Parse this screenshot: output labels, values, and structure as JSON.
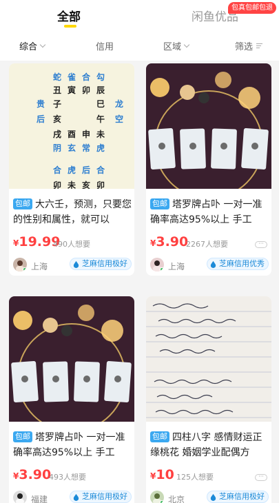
{
  "tabs": {
    "all": "全部",
    "xianyu_pick": "闲鱼优品",
    "promo": "包真包邮包退"
  },
  "filters": {
    "comprehensive": "综合",
    "credit": "信用",
    "region": "区域",
    "filter": "筛选"
  },
  "products": [
    {
      "badge": "包邮",
      "title": "大六壬，预测，只要您的性别和属性，就可以",
      "currency": "¥",
      "price": "19.99",
      "wants": "490人想要",
      "location": "上海",
      "credit": "芝麻信用极好"
    },
    {
      "badge": "包邮",
      "title": "塔罗牌占卟 一对一准确率高达95%以上 手工",
      "currency": "¥",
      "price": "3.90",
      "wants": "2267人想要",
      "location": "上海",
      "credit": "芝麻信用优秀"
    },
    {
      "badge": "包邮",
      "title": "塔罗牌占卟 一对一准确率高达95%以上 手工",
      "currency": "¥",
      "price": "3.90",
      "wants": "493人想要",
      "location": "福建",
      "credit": "芝麻信用极好"
    },
    {
      "badge": "包邮",
      "title": "四柱八字  感情财运正缘桃花  婚姻学业配偶方",
      "currency": "¥",
      "price": "10",
      "wants": "125人想要",
      "location": "北京",
      "credit": "芝麻信用极好"
    }
  ],
  "chart_text": {
    "rows": [
      [
        "蛇",
        "雀",
        "合",
        "勾"
      ],
      [
        "丑",
        "寅",
        "卯",
        "辰"
      ],
      [
        "贵",
        "子",
        "巳",
        "龙"
      ],
      [
        "后",
        "亥",
        "午",
        "空"
      ],
      [
        "戌",
        "酉",
        "申",
        "未"
      ],
      [
        "阴",
        "玄",
        "常",
        "虎"
      ],
      [
        "合",
        "虎",
        "后",
        "合"
      ],
      [
        "卯",
        "未",
        "亥",
        "卯"
      ]
    ]
  },
  "colors": {
    "accent_yellow": "#ffd800",
    "price_red": "#ff4040",
    "badge_blue": "#3ba8f0",
    "credit_blue": "#1b8ad8",
    "promo_red": "#ff4444"
  }
}
